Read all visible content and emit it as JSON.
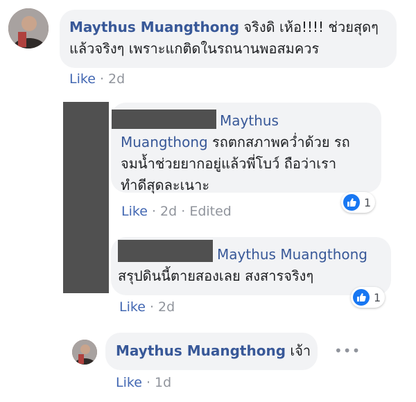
{
  "comments": [
    {
      "author": "Maythus Muangthong",
      "text_line1": "จริงดิ เห้อ!!!! ช่วยสุดๆ",
      "text_line2": "แล้วจริงๆ เพราะแกติดในรถนานพอสมควร",
      "like_label": "Like",
      "time": "2d"
    },
    {
      "mention_part1": "Maythus",
      "mention_part2": "Muangthong",
      "text_line1": "รถตกสภาพคว่ำด้วย รถ",
      "text_line2": "จมน้ำช่วยยากอยู่แล้วพี่โบว์ ถือว่าเรา",
      "text_line3": "ทำดีสุดละเนาะ",
      "like_label": "Like",
      "time": "2d",
      "edited": "Edited",
      "reaction_count": "1"
    },
    {
      "mention": "Maythus Muangthong",
      "text_line1": "สรุปดินนี้ตายสองเลย สงสารจริงๆ",
      "like_label": "Like",
      "time": "2d",
      "reaction_count": "1"
    },
    {
      "author": "Maythus Muangthong",
      "text": "เจ้า",
      "like_label": "Like",
      "time": "1d",
      "more_icon": "more-dots-icon"
    }
  ],
  "icons": {
    "reaction": "thumbs-up-icon"
  },
  "colors": {
    "link": "#385898",
    "like": "#4267b2",
    "bubble": "#f2f3f5",
    "reaction": "#1877f2"
  }
}
